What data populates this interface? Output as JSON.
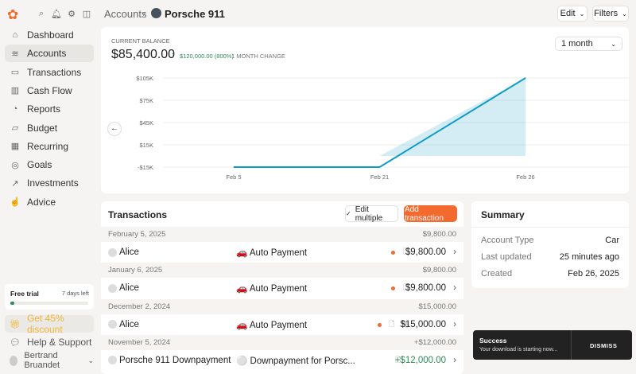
{
  "header": {
    "breadcrumb_parent": "Accounts",
    "account_name": "Porsche 911",
    "edit_label": "Edit",
    "filters_label": "Filters"
  },
  "sidebar": {
    "items": [
      {
        "label": "Dashboard",
        "icon": "home-icon"
      },
      {
        "label": "Accounts",
        "icon": "layers-icon",
        "active": true
      },
      {
        "label": "Transactions",
        "icon": "credit-card-icon"
      },
      {
        "label": "Cash Flow",
        "icon": "bar-chart-icon"
      },
      {
        "label": "Reports",
        "icon": "pie-chart-icon"
      },
      {
        "label": "Budget",
        "icon": "map-icon"
      },
      {
        "label": "Recurring",
        "icon": "calendar-icon"
      },
      {
        "label": "Goals",
        "icon": "target-icon"
      },
      {
        "label": "Investments",
        "icon": "trending-up-icon"
      },
      {
        "label": "Advice",
        "icon": "thumbs-up-icon"
      }
    ],
    "trial": {
      "label": "Free trial",
      "days_left": "7 days left",
      "progress": 0.05
    },
    "discount": "Get 45% discount",
    "help": "Help & Support",
    "user": "Bertrand Bruandet"
  },
  "balance": {
    "label": "CURRENT BALANCE",
    "amount": "$85,400.00",
    "change": "$120,000.00 (800%)",
    "change_label": "1 MONTH CHANGE",
    "period": "1 month"
  },
  "chart_data": {
    "type": "area",
    "x": [
      "Feb 5",
      "Feb 21",
      "Feb 26"
    ],
    "values": [
      -15000,
      -15000,
      105000
    ],
    "yticks": [
      "$105K",
      "$75K",
      "$45K",
      "$15K",
      "-$15K"
    ],
    "ylim": [
      -15000,
      105000
    ],
    "grid": true,
    "color": "#0f9bc6"
  },
  "transactions": {
    "title": "Transactions",
    "edit_multiple": "Edit multiple",
    "add": "Add transaction",
    "groups": [
      {
        "date": "February 5, 2025",
        "total": "$9,800.00",
        "merchant": "Alice",
        "category": "🚗 Auto Payment",
        "amount": "$9,800.00",
        "positive": false
      },
      {
        "date": "January 6, 2025",
        "total": "$9,800.00",
        "merchant": "Alice",
        "category": "🚗 Auto Payment",
        "amount": "$9,800.00",
        "positive": false
      },
      {
        "date": "December 2, 2024",
        "total": "$15,000.00",
        "merchant": "Alice",
        "category": "🚗 Auto Payment",
        "amount": "$15,000.00",
        "positive": false
      },
      {
        "date": "November 5, 2024",
        "total": "+$12,000.00",
        "merchant": "Porsche 911 Downpayment",
        "category": "⚪ Downpayment for Porsc...",
        "amount": "+$12,000.00",
        "positive": true
      }
    ]
  },
  "summary": {
    "title": "Summary",
    "rows": [
      {
        "label": "Account Type",
        "value": "Car"
      },
      {
        "label": "Last updated",
        "value": "25 minutes ago"
      },
      {
        "label": "Created",
        "value": "Feb 26, 2025"
      }
    ]
  },
  "toast": {
    "title": "Success",
    "message": "Your download is starting now...",
    "dismiss": "DISMISS"
  },
  "colors": {
    "accent": "#f26a2e",
    "positive": "#2e8b57",
    "chart": "#0f9bc6"
  }
}
